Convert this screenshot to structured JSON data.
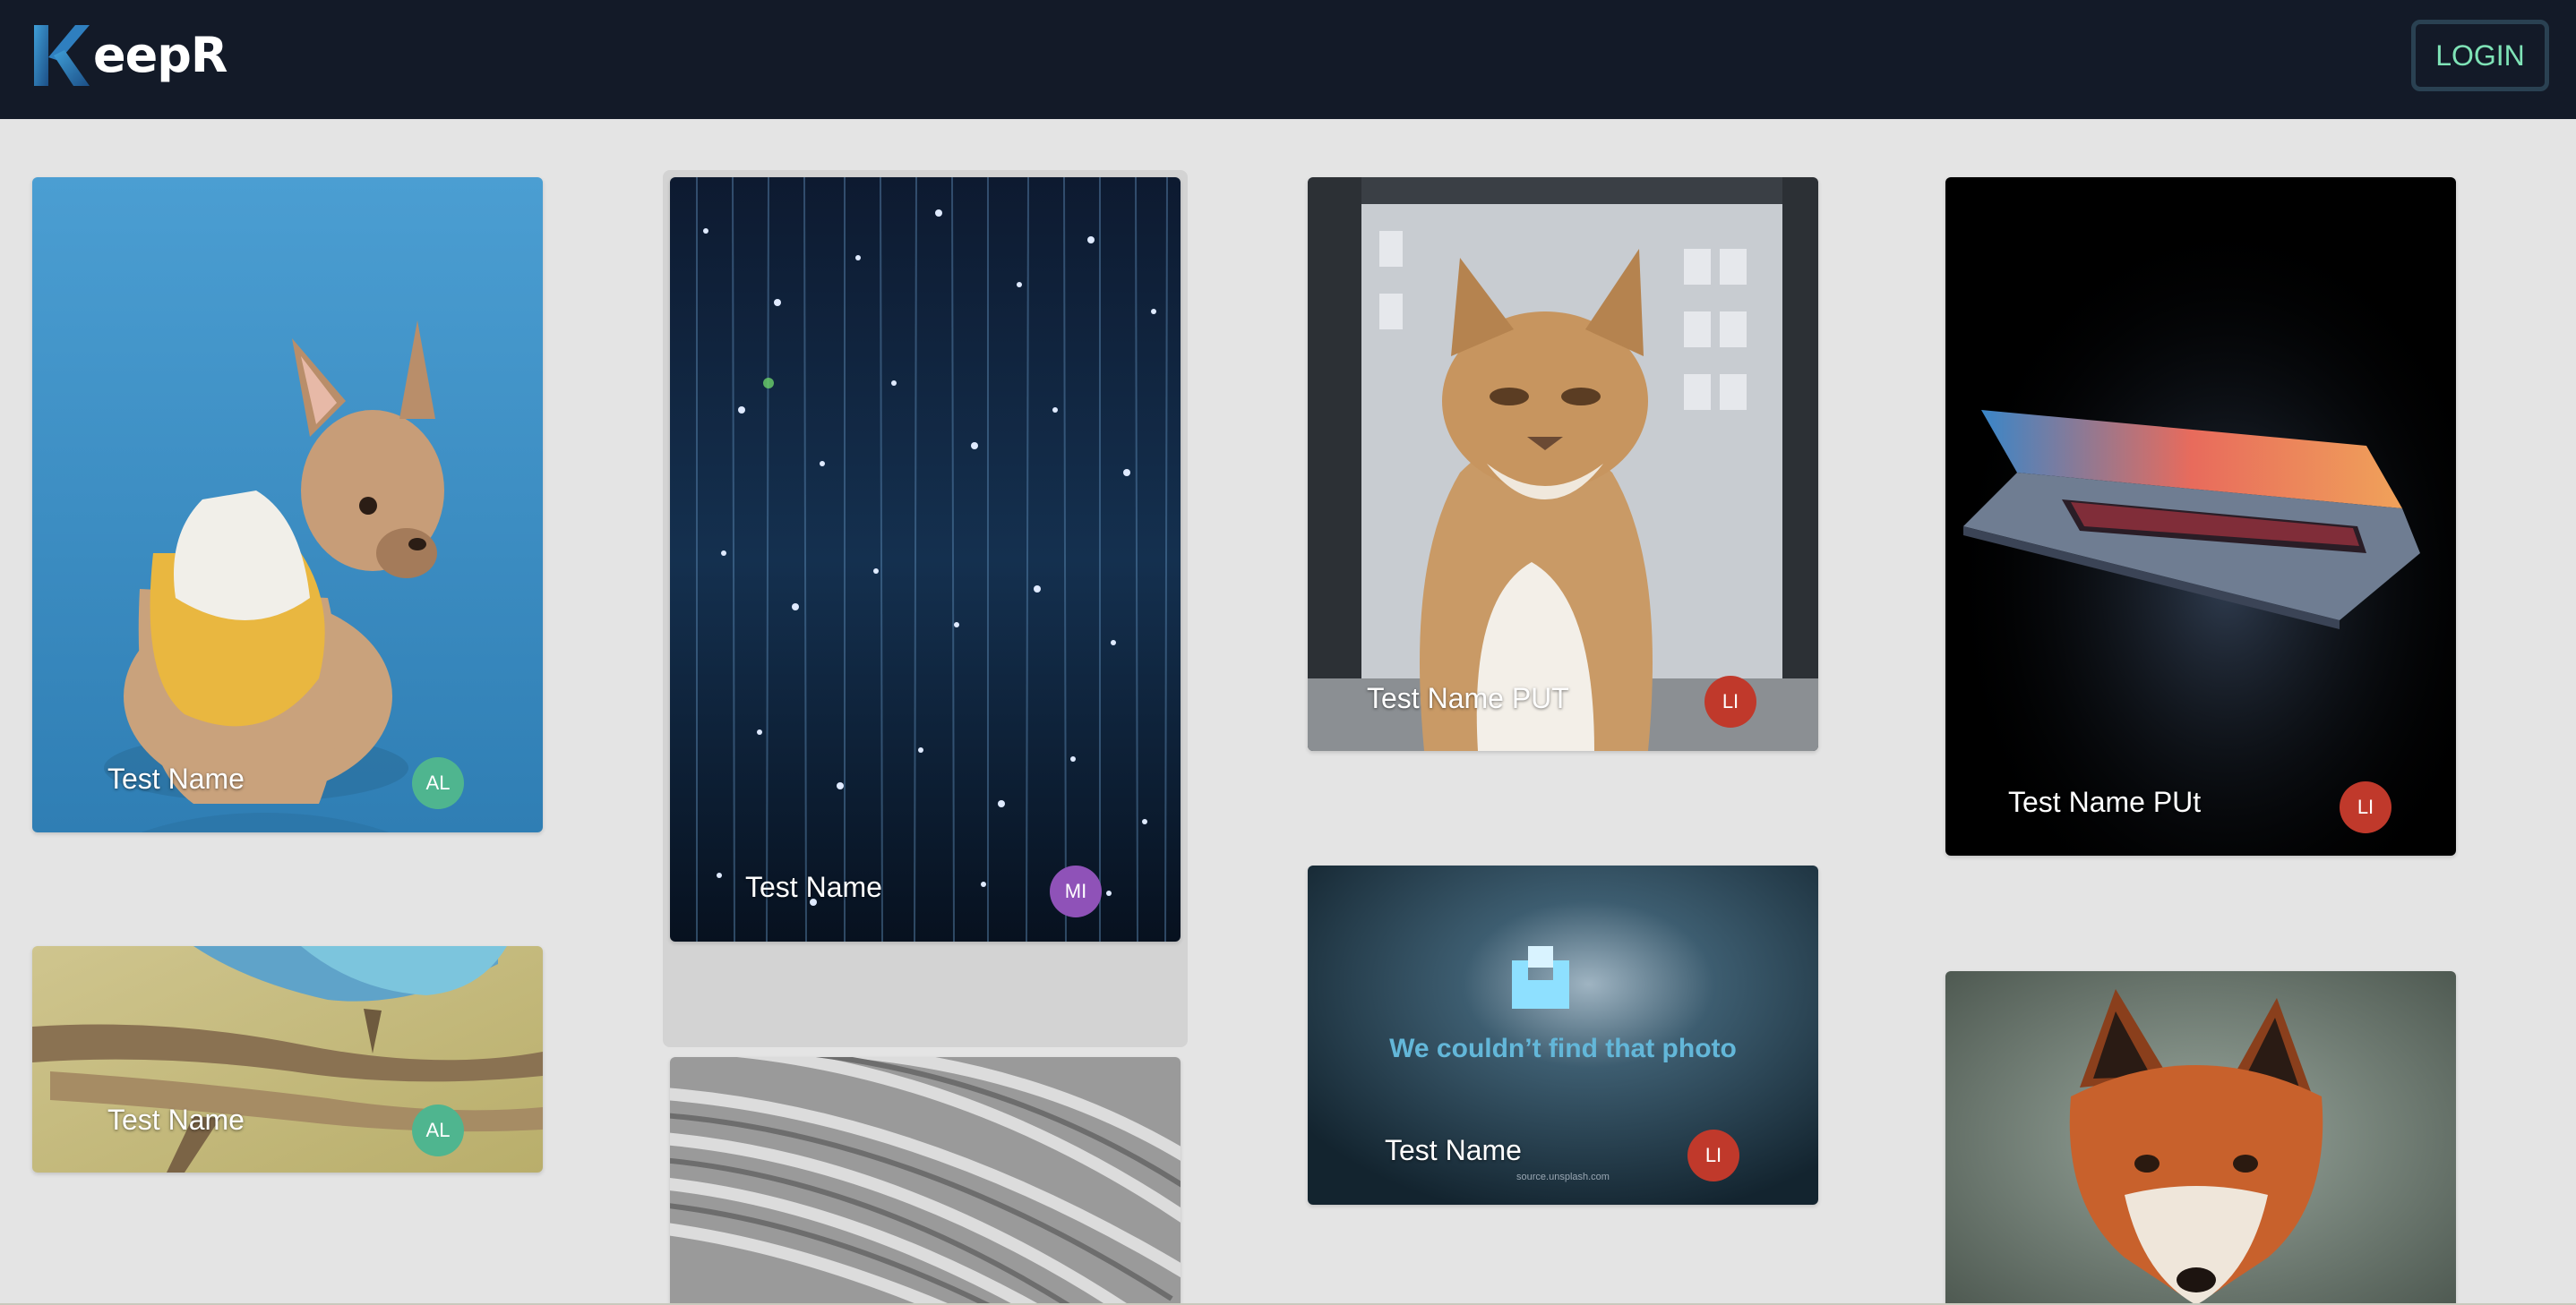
{
  "app": {
    "logo_mark": "K",
    "logo_text": "eepR",
    "login_label": "LOGIN"
  },
  "colors": {
    "navbar_bg": "#131a28",
    "page_bg": "#e4e4e4",
    "login_text": "#7fe3b7",
    "avatar_green": "#4fb58f",
    "avatar_purple": "#8f52b8",
    "avatar_red": "#c0392b"
  },
  "keeps": [
    {
      "name": "Test Name",
      "creator_initials": "AL",
      "image": "french bulldog in yellow hoodie on blue background"
    },
    {
      "name": "Test Name",
      "creator_initials": "AL",
      "image": "blue bird perched on branch"
    },
    {
      "name": "Test Name",
      "creator_initials": "MI",
      "image": "starry light strands in dark room"
    },
    {
      "name": "",
      "creator_initials": "",
      "image": "grey curved architecture"
    },
    {
      "name": "Test Name PUT",
      "creator_initials": "LI",
      "image": "grumpy cat by window"
    },
    {
      "name": "Test Name",
      "creator_initials": "LI",
      "image": "unsplash photo not found placeholder",
      "placeholder_title": "We couldn’t find that photo",
      "placeholder_source": "source.unsplash.com"
    },
    {
      "name": "Test Name PUt",
      "creator_initials": "LI",
      "image": "open laptop in the dark"
    },
    {
      "name": "",
      "creator_initials": "",
      "image": "red fox portrait"
    }
  ]
}
